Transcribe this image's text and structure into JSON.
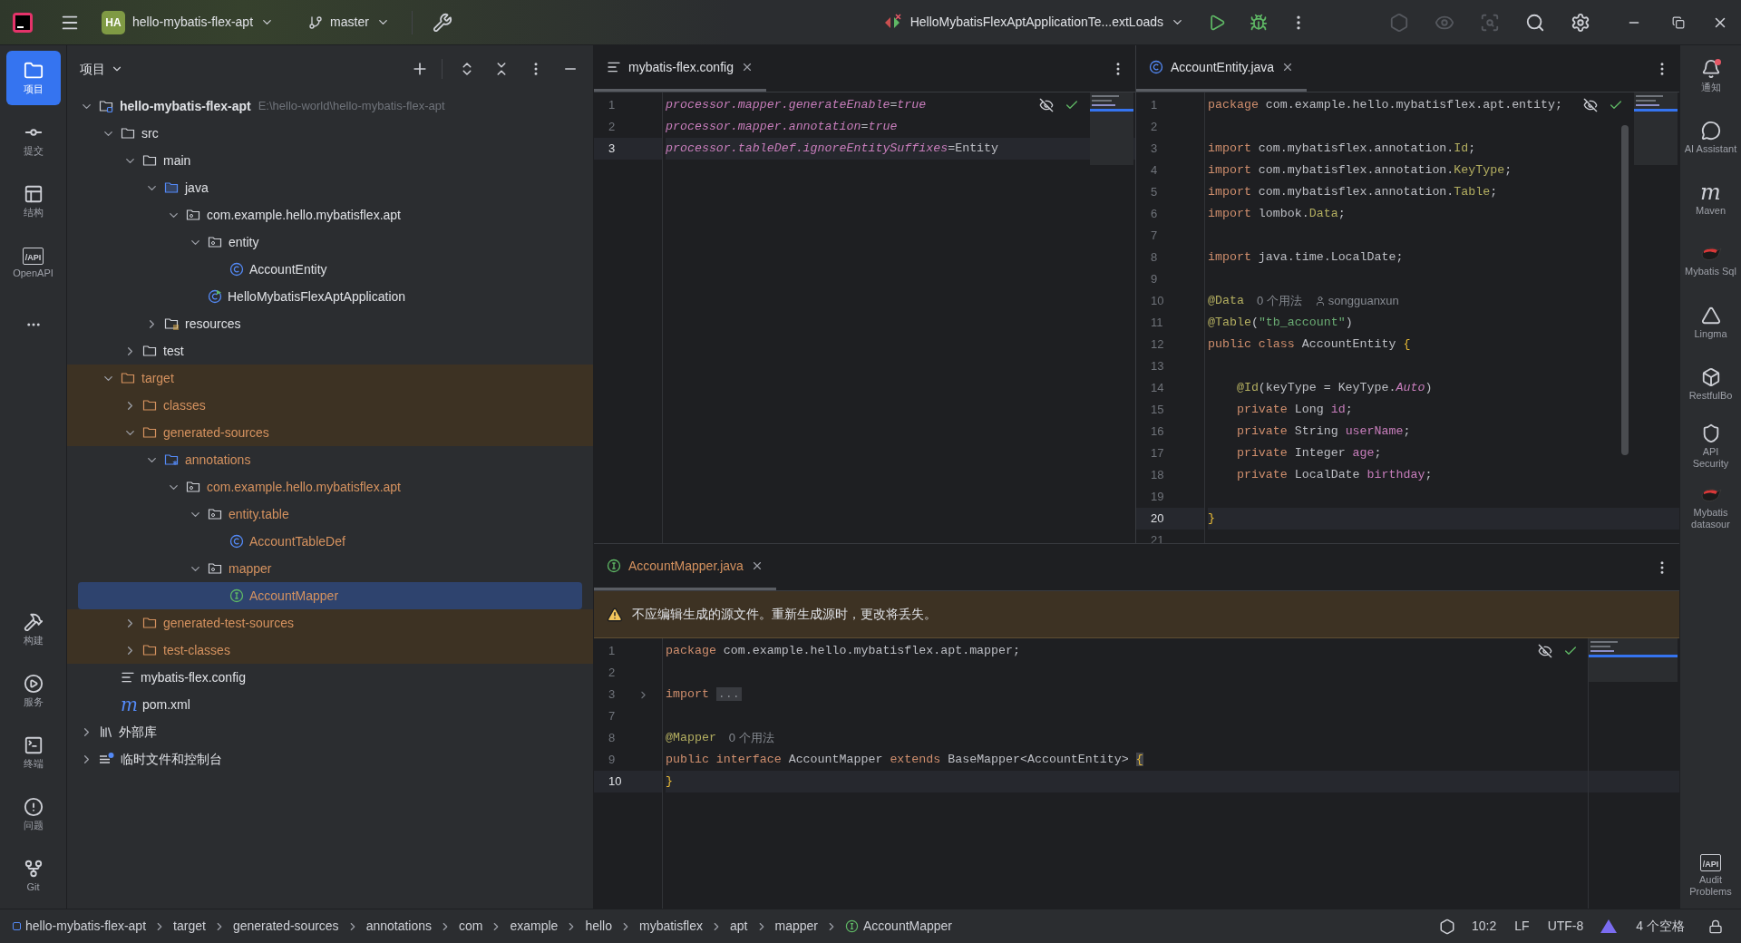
{
  "title_bar": {
    "project": {
      "badge": "HA",
      "name": "hello-mybatis-flex-apt"
    },
    "branch": "master",
    "run_config": "HelloMybatisFlexAptApplicationTe...extLoads"
  },
  "tool_strip_left": {
    "top": [
      {
        "label": "项目",
        "kind": "folder",
        "selected": true
      },
      {
        "label": "提交",
        "kind": "commit",
        "selected": false
      },
      {
        "label": "结构",
        "kind": "structure",
        "selected": false
      },
      {
        "label": "OpenAPI",
        "kind": "api",
        "glyph": "/API",
        "selected": false
      },
      {
        "kind": "more",
        "selected": false
      }
    ],
    "bottom": [
      {
        "label": "构建",
        "kind": "hammer",
        "selected": false
      },
      {
        "label": "服务",
        "kind": "services",
        "selected": false
      },
      {
        "label": "终端",
        "kind": "terminal",
        "selected": false
      },
      {
        "label": "问题",
        "kind": "problems",
        "selected": false
      },
      {
        "label": "Git",
        "kind": "git",
        "selected": false
      }
    ]
  },
  "project": {
    "title": "项目",
    "tree": [
      {
        "label": "hello-mybatis-flex-apt",
        "path": "E:\\hello-world\\hello-mybatis-flex-apt",
        "kind": "module",
        "expanded": true,
        "selected": false,
        "highlighted": false,
        "children": [
          {
            "label": "src",
            "kind": "folder",
            "expanded": true,
            "selected": false,
            "highlighted": false,
            "children": [
              {
                "label": "main",
                "kind": "folder",
                "expanded": true,
                "selected": false,
                "highlighted": false,
                "children": [
                  {
                    "label": "java",
                    "kind": "source",
                    "expanded": true,
                    "selected": false,
                    "highlighted": false,
                    "children": [
                      {
                        "label": "com.example.hello.mybatisflex.apt",
                        "kind": "package",
                        "expanded": true,
                        "selected": false,
                        "highlighted": false,
                        "children": [
                          {
                            "label": "entity",
                            "kind": "package",
                            "expanded": true,
                            "selected": false,
                            "highlighted": false,
                            "children": [
                              {
                                "label": "AccountEntity",
                                "kind": "class",
                                "selected": false,
                                "highlighted": false
                              }
                            ]
                          },
                          {
                            "label": "HelloMybatisFlexAptApplication",
                            "kind": "app",
                            "selected": false,
                            "highlighted": false
                          }
                        ]
                      }
                    ]
                  },
                  {
                    "label": "resources",
                    "kind": "resources",
                    "expanded": false,
                    "selected": false,
                    "highlighted": false
                  }
                ]
              },
              {
                "label": "test",
                "kind": "folder",
                "expanded": false,
                "selected": false,
                "highlighted": false
              }
            ]
          },
          {
            "label": "target",
            "kind": "excluded",
            "expanded": true,
            "selected": false,
            "highlighted": true,
            "children": [
              {
                "label": "classes",
                "kind": "excluded",
                "expanded": false,
                "selected": false,
                "highlighted": true
              },
              {
                "label": "generated-sources",
                "kind": "excluded",
                "expanded": true,
                "selected": false,
                "highlighted": true,
                "children": [
                  {
                    "label": "annotations",
                    "kind": "gensource",
                    "expanded": true,
                    "selected": false,
                    "highlighted": false,
                    "children": [
                      {
                        "label": "com.example.hello.mybatisflex.apt",
                        "kind": "package",
                        "expanded": true,
                        "selected": false,
                        "highlighted": false,
                        "children": [
                          {
                            "label": "entity.table",
                            "kind": "package",
                            "expanded": true,
                            "selected": false,
                            "highlighted": false,
                            "children": [
                              {
                                "label": "AccountTableDef",
                                "kind": "class",
                                "selected": false,
                                "highlighted": false
                              }
                            ]
                          },
                          {
                            "label": "mapper",
                            "kind": "package",
                            "expanded": true,
                            "selected": false,
                            "highlighted": false,
                            "children": [
                              {
                                "label": "AccountMapper",
                                "kind": "interface",
                                "selected": true
                              }
                            ]
                          }
                        ]
                      }
                    ]
                  }
                ]
              },
              {
                "label": "generated-test-sources",
                "kind": "excluded",
                "expanded": false,
                "selected": false,
                "highlighted": true
              },
              {
                "label": "test-classes",
                "kind": "excluded",
                "expanded": false,
                "selected": false,
                "highlighted": true
              }
            ]
          },
          {
            "label": "mybatis-flex.config",
            "kind": "config",
            "selected": false,
            "highlighted": false
          },
          {
            "label": "pom.xml",
            "kind": "maven",
            "glyph": "m",
            "selected": false,
            "highlighted": false
          }
        ]
      },
      {
        "label": "外部库",
        "kind": "library",
        "expanded": false,
        "selected": false,
        "highlighted": false
      },
      {
        "label": "临时文件和控制台",
        "kind": "scratch",
        "expanded": false,
        "selected": false,
        "highlighted": false
      }
    ]
  },
  "editors": {
    "top": [
      {
        "tabs": [
          {
            "label": "mybatis-flex.config",
            "kind": "config",
            "selected": true,
            "generated": false
          }
        ],
        "lines": [
          {
            "n": "1",
            "current": false,
            "t": [
              {
                "kind": "it",
                "text": "processor.mapper.generateEnable"
              },
              {
                "kind": "p",
                "text": "="
              },
              {
                "kind": "it",
                "text": "true"
              }
            ]
          },
          {
            "n": "2",
            "current": false,
            "t": [
              {
                "kind": "it",
                "text": "processor.mapper.annotation"
              },
              {
                "kind": "p",
                "text": "="
              },
              {
                "kind": "it",
                "text": "true"
              }
            ]
          },
          {
            "n": "3",
            "current": true,
            "t": [
              {
                "kind": "it",
                "text": "processor.tableDef.ignoreEntitySuffixes"
              },
              {
                "kind": "p",
                "text": "=Entity"
              }
            ]
          }
        ]
      },
      {
        "tabs": [
          {
            "label": "AccountEntity.java",
            "kind": "class",
            "selected": true,
            "generated": false
          }
        ],
        "lines": [
          {
            "n": "1",
            "current": false,
            "t": [
              {
                "kind": "kw",
                "text": "package"
              },
              {
                "kind": "p",
                "text": " com.example.hello.mybatisflex.apt.entity;"
              }
            ]
          },
          {
            "n": "2",
            "current": false
          },
          {
            "n": "3",
            "current": false,
            "t": [
              {
                "kind": "kw",
                "text": "import"
              },
              {
                "kind": "p",
                "text": " com.mybatisflex.annotation."
              },
              {
                "kind": "ann",
                "text": "Id"
              },
              {
                "kind": "p",
                "text": ";"
              }
            ]
          },
          {
            "n": "4",
            "current": false,
            "t": [
              {
                "kind": "kw",
                "text": "import"
              },
              {
                "kind": "p",
                "text": " com.mybatisflex.annotation."
              },
              {
                "kind": "ann",
                "text": "KeyType"
              },
              {
                "kind": "p",
                "text": ";"
              }
            ]
          },
          {
            "n": "5",
            "current": false,
            "t": [
              {
                "kind": "kw",
                "text": "import"
              },
              {
                "kind": "p",
                "text": " com.mybatisflex.annotation."
              },
              {
                "kind": "ann",
                "text": "Table"
              },
              {
                "kind": "p",
                "text": ";"
              }
            ]
          },
          {
            "n": "6",
            "current": false,
            "t": [
              {
                "kind": "kw",
                "text": "import"
              },
              {
                "kind": "p",
                "text": " lombok."
              },
              {
                "kind": "ann",
                "text": "Data"
              },
              {
                "kind": "p",
                "text": ";"
              }
            ]
          },
          {
            "n": "7",
            "current": false
          },
          {
            "n": "8",
            "current": false,
            "t": [
              {
                "kind": "kw",
                "text": "import"
              },
              {
                "kind": "p",
                "text": " java.time.LocalDate;"
              }
            ]
          },
          {
            "n": "9",
            "current": false
          },
          {
            "n": "10",
            "current": false,
            "t": [
              {
                "kind": "ann",
                "text": "@Data"
              }
            ],
            "hints": [
              {
                "kind": "usages",
                "text": "0 个用法"
              },
              {
                "kind": "author",
                "text": "songguanxun"
              }
            ]
          },
          {
            "n": "11",
            "current": false,
            "t": [
              {
                "kind": "ann",
                "text": "@Table"
              },
              {
                "kind": "p",
                "text": "("
              },
              {
                "kind": "str",
                "text": "\"tb_account\""
              },
              {
                "kind": "p",
                "text": ")"
              }
            ]
          },
          {
            "n": "12",
            "current": false,
            "t": [
              {
                "kind": "kw",
                "text": "public class"
              },
              {
                "kind": "p",
                "text": " AccountEntity "
              },
              {
                "kind": "brace",
                "text": "{"
              }
            ]
          },
          {
            "n": "13",
            "current": false
          },
          {
            "n": "14",
            "current": false,
            "t": [
              {
                "kind": "ann",
                "text": "    @Id"
              },
              {
                "kind": "p",
                "text": "(keyType = KeyType."
              },
              {
                "kind": "it",
                "text": "Auto"
              },
              {
                "kind": "p",
                "text": ")"
              }
            ]
          },
          {
            "n": "15",
            "current": false,
            "t": [
              {
                "kind": "kw",
                "text": "    private"
              },
              {
                "kind": "p",
                "text": " Long "
              },
              {
                "kind": "fld",
                "text": "id"
              },
              {
                "kind": "p",
                "text": ";"
              }
            ]
          },
          {
            "n": "16",
            "current": false,
            "t": [
              {
                "kind": "kw",
                "text": "    private"
              },
              {
                "kind": "p",
                "text": " String "
              },
              {
                "kind": "fld",
                "text": "userName"
              },
              {
                "kind": "p",
                "text": ";"
              }
            ]
          },
          {
            "n": "17",
            "current": false,
            "t": [
              {
                "kind": "kw",
                "text": "    private"
              },
              {
                "kind": "p",
                "text": " Integer "
              },
              {
                "kind": "fld",
                "text": "age"
              },
              {
                "kind": "p",
                "text": ";"
              }
            ]
          },
          {
            "n": "18",
            "current": false,
            "t": [
              {
                "kind": "kw",
                "text": "    private"
              },
              {
                "kind": "p",
                "text": " LocalDate "
              },
              {
                "kind": "fld",
                "text": "birthday"
              },
              {
                "kind": "p",
                "text": ";"
              }
            ]
          },
          {
            "n": "19",
            "current": false
          },
          {
            "n": "20",
            "current": true,
            "t": [
              {
                "kind": "brace",
                "text": "}"
              }
            ]
          },
          {
            "n": "21",
            "current": false
          }
        ]
      }
    ],
    "bottom": {
      "tabs": [
        {
          "label": "AccountMapper.java",
          "kind": "interface",
          "selected": true,
          "generated": true
        }
      ],
      "warning": "不应编辑生成的源文件。重新生成源时，更改将丢失。",
      "lines": [
        {
          "n": "1",
          "current": false,
          "t": [
            {
              "kind": "kw",
              "text": "package"
            },
            {
              "kind": "p",
              "text": " com.example.hello.mybatisflex.apt.mapper;"
            }
          ]
        },
        {
          "n": "2",
          "current": false
        },
        {
          "n": "3",
          "current": false,
          "folded": true,
          "t": [
            {
              "kind": "kw",
              "text": "import "
            },
            {
              "kind": "fold",
              "text": "..."
            }
          ]
        },
        {
          "n": "7",
          "current": false
        },
        {
          "n": "8",
          "current": false,
          "t": [
            {
              "kind": "ann",
              "text": "@Mapper"
            }
          ],
          "hints": [
            {
              "kind": "usages",
              "text": "0 个用法"
            }
          ]
        },
        {
          "n": "9",
          "current": false,
          "t": [
            {
              "kind": "kw",
              "text": "public interface"
            },
            {
              "kind": "p",
              "text": " AccountMapper "
            },
            {
              "kind": "kw",
              "text": "extends"
            },
            {
              "kind": "p",
              "text": " BaseMapper<AccountEntity> "
            },
            {
              "kind": "match",
              "text": "{"
            }
          ]
        },
        {
          "n": "10",
          "current": true,
          "t": [
            {
              "kind": "brace",
              "text": "}"
            }
          ]
        }
      ]
    }
  },
  "tool_strip_right": {
    "top": [
      {
        "label": "通知",
        "kind": "bell",
        "selected": false
      },
      {
        "label": "AI Assistant",
        "kind": "ai",
        "selected": false
      },
      {
        "label": "Maven",
        "kind": "maven",
        "glyph": "m",
        "selected": false
      },
      {
        "label": "Mybatis Sql",
        "kind": "bird",
        "selected": false
      },
      {
        "label": "Lingma",
        "kind": "lingma",
        "selected": false
      },
      {
        "label": "RestfulBo",
        "kind": "box",
        "selected": false
      },
      {
        "label": "API Security",
        "kind": "shield",
        "selected": false
      },
      {
        "label": "Mybatis datasour",
        "kind": "bird",
        "selected": false
      }
    ],
    "bottom": [
      {
        "label": "Audit Problems",
        "kind": "api",
        "glyph": "/API",
        "selected": false
      }
    ]
  },
  "status_bar": {
    "breadcrumbs": [
      {
        "label": "hello-mybatis-flex-apt",
        "kind": "module"
      },
      {
        "label": "target",
        "kind": "plain"
      },
      {
        "label": "generated-sources",
        "kind": "plain"
      },
      {
        "label": "annotations",
        "kind": "plain"
      },
      {
        "label": "com",
        "kind": "plain"
      },
      {
        "label": "example",
        "kind": "plain"
      },
      {
        "label": "hello",
        "kind": "plain"
      },
      {
        "label": "mybatisflex",
        "kind": "plain"
      },
      {
        "label": "apt",
        "kind": "plain"
      },
      {
        "label": "mapper",
        "kind": "plain"
      },
      {
        "label": "AccountMapper",
        "kind": "interface"
      }
    ],
    "caret": "10:2",
    "line_separator": "LF",
    "encoding": "UTF-8",
    "indent": "4 个空格"
  }
}
